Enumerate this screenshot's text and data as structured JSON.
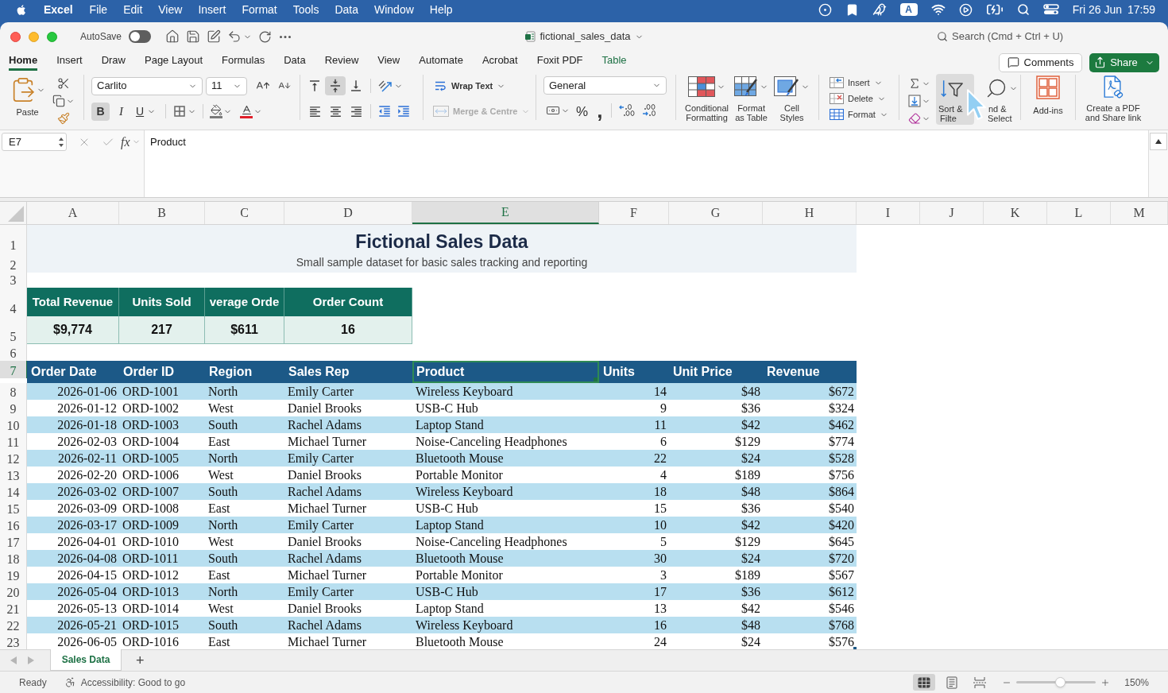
{
  "menu_bar": {
    "app_name": "Excel",
    "menus": [
      "File",
      "Edit",
      "View",
      "Insert",
      "Format",
      "Tools",
      "Data",
      "Window",
      "Help"
    ],
    "input_source": "A",
    "date": "Fri 26 Jun",
    "time": "17:59"
  },
  "title_bar": {
    "autosave": {
      "label": "AutoSave",
      "on": false
    },
    "file_name": "fictional_sales_data",
    "search": {
      "placeholder": "Search (Cmd + Ctrl + U)"
    }
  },
  "ribbon_tabs": [
    {
      "label": "Home",
      "selected": true,
      "contextual": false
    },
    {
      "label": "Insert",
      "selected": false,
      "contextual": false
    },
    {
      "label": "Draw",
      "selected": false,
      "contextual": false
    },
    {
      "label": "Page Layout",
      "selected": false,
      "contextual": false
    },
    {
      "label": "Formulas",
      "selected": false,
      "contextual": false
    },
    {
      "label": "Data",
      "selected": false,
      "contextual": false
    },
    {
      "label": "Review",
      "selected": false,
      "contextual": false
    },
    {
      "label": "View",
      "selected": false,
      "contextual": false
    },
    {
      "label": "Automate",
      "selected": false,
      "contextual": false
    },
    {
      "label": "Acrobat",
      "selected": false,
      "contextual": false
    },
    {
      "label": "Foxit PDF",
      "selected": false,
      "contextual": false
    },
    {
      "label": "Table",
      "selected": false,
      "contextual": true
    }
  ],
  "comments_button": {
    "label": "Comments"
  },
  "share_button": {
    "label": "Share"
  },
  "ribbon": {
    "paste": {
      "label": "Paste"
    },
    "font_name": "Carlito",
    "font_size": "11",
    "text_styles": [
      {
        "label": "B",
        "kind": "bold",
        "selected": true
      },
      {
        "label": "I",
        "kind": "italic",
        "selected": false
      },
      {
        "label": "U",
        "kind": "underline",
        "selected": false
      }
    ],
    "vertical_align": [
      {
        "kind": "top",
        "selected": false
      },
      {
        "kind": "middle",
        "selected": true
      },
      {
        "kind": "bottom",
        "selected": false
      }
    ],
    "wrap_text": {
      "label": "Wrap Text",
      "disabled": false
    },
    "merge_centre": {
      "label": "Merge & Centre",
      "disabled": true
    },
    "number_format": "General",
    "percent_symbol": "%",
    "comma_symbol": ",",
    "style_buttons": [
      {
        "kind": "conditional",
        "lines": [
          "Conditional",
          "Formatting"
        ]
      },
      {
        "kind": "table",
        "lines": [
          "Format",
          "as Table"
        ]
      },
      {
        "kind": "cell",
        "lines": [
          "Cell",
          "Styles"
        ]
      }
    ],
    "cells_buttons": [
      {
        "kind": "insert",
        "label": "Insert"
      },
      {
        "kind": "delete",
        "label": "Delete"
      },
      {
        "kind": "format",
        "label": "Format"
      }
    ],
    "sort_filter": {
      "lines": [
        "Sort &",
        "Filte"
      ],
      "hovered": true
    },
    "find_select": {
      "lines": [
        "nd &",
        "Select"
      ]
    },
    "add_ins": {
      "label": "Add-ins"
    },
    "create_pdf": {
      "lines": [
        "Create a PDF",
        "and Share link"
      ]
    }
  },
  "formula_bar": {
    "name_box": "E7",
    "function_label": "fx",
    "value": "Product"
  },
  "sheet": {
    "columns": [
      {
        "label": "A",
        "selected": false
      },
      {
        "label": "B",
        "selected": false
      },
      {
        "label": "C",
        "selected": false
      },
      {
        "label": "D",
        "selected": false
      },
      {
        "label": "E",
        "selected": true
      },
      {
        "label": "F",
        "selected": false
      },
      {
        "label": "G",
        "selected": false
      },
      {
        "label": "H",
        "selected": false
      },
      {
        "label": "I",
        "selected": false
      },
      {
        "label": "J",
        "selected": false
      },
      {
        "label": "K",
        "selected": false
      },
      {
        "label": "L",
        "selected": false
      },
      {
        "label": "M",
        "selected": false
      }
    ],
    "rows": [
      {
        "label": "1",
        "selected": false
      },
      {
        "label": "2",
        "selected": false
      },
      {
        "label": "3",
        "selected": false
      },
      {
        "label": "4",
        "selected": false
      },
      {
        "label": "5",
        "selected": false
      },
      {
        "label": "6",
        "selected": false
      },
      {
        "label": "7",
        "selected": true
      },
      {
        "label": "8",
        "selected": false
      },
      {
        "label": "9",
        "selected": false
      },
      {
        "label": "10",
        "selected": false
      },
      {
        "label": "11",
        "selected": false
      },
      {
        "label": "12",
        "selected": false
      },
      {
        "label": "13",
        "selected": false
      },
      {
        "label": "14",
        "selected": false
      },
      {
        "label": "15",
        "selected": false
      },
      {
        "label": "16",
        "selected": false
      },
      {
        "label": "17",
        "selected": false
      },
      {
        "label": "18",
        "selected": false
      },
      {
        "label": "19",
        "selected": false
      },
      {
        "label": "20",
        "selected": false
      },
      {
        "label": "21",
        "selected": false
      },
      {
        "label": "22",
        "selected": false
      },
      {
        "label": "23",
        "selected": false
      }
    ],
    "title": "Fictional Sales Data",
    "subtitle": "Small sample dataset for basic sales tracking and reporting",
    "kpis": [
      {
        "label": "Total Revenue",
        "value": "$9,774"
      },
      {
        "label": "Units Sold",
        "value": "217"
      },
      {
        "label": "verage Orde",
        "value": "$611"
      },
      {
        "label": "Order Count",
        "value": "16"
      }
    ],
    "table": {
      "columns": [
        {
          "label": "Order Date",
          "kind": "date",
          "selected": false
        },
        {
          "label": "Order ID",
          "kind": "text",
          "selected": false
        },
        {
          "label": "Region",
          "kind": "text",
          "selected": false
        },
        {
          "label": "Sales Rep",
          "kind": "text",
          "selected": false
        },
        {
          "label": "Product",
          "kind": "text",
          "selected": true
        },
        {
          "label": "Units",
          "kind": "number",
          "selected": false
        },
        {
          "label": "Unit Price",
          "kind": "number",
          "selected": false
        },
        {
          "label": "Revenue",
          "kind": "number",
          "selected": false
        }
      ],
      "rows": [
        [
          "2026-01-06",
          "ORD-1001",
          "North",
          "Emily Carter",
          "Wireless Keyboard",
          "14",
          "$48",
          "$672"
        ],
        [
          "2026-01-12",
          "ORD-1002",
          "West",
          "Daniel Brooks",
          "USB-C Hub",
          "9",
          "$36",
          "$324"
        ],
        [
          "2026-01-18",
          "ORD-1003",
          "South",
          "Rachel Adams",
          "Laptop Stand",
          "11",
          "$42",
          "$462"
        ],
        [
          "2026-02-03",
          "ORD-1004",
          "East",
          "Michael Turner",
          "Noise-Canceling Headphones",
          "6",
          "$129",
          "$774"
        ],
        [
          "2026-02-11",
          "ORD-1005",
          "North",
          "Emily Carter",
          "Bluetooth Mouse",
          "22",
          "$24",
          "$528"
        ],
        [
          "2026-02-20",
          "ORD-1006",
          "West",
          "Daniel Brooks",
          "Portable Monitor",
          "4",
          "$189",
          "$756"
        ],
        [
          "2026-03-02",
          "ORD-1007",
          "South",
          "Rachel Adams",
          "Wireless Keyboard",
          "18",
          "$48",
          "$864"
        ],
        [
          "2026-03-09",
          "ORD-1008",
          "East",
          "Michael Turner",
          "USB-C Hub",
          "15",
          "$36",
          "$540"
        ],
        [
          "2026-03-17",
          "ORD-1009",
          "North",
          "Emily Carter",
          "Laptop Stand",
          "10",
          "$42",
          "$420"
        ],
        [
          "2026-04-01",
          "ORD-1010",
          "West",
          "Daniel Brooks",
          "Noise-Canceling Headphones",
          "5",
          "$129",
          "$645"
        ],
        [
          "2026-04-08",
          "ORD-1011",
          "South",
          "Rachel Adams",
          "Bluetooth Mouse",
          "30",
          "$24",
          "$720"
        ],
        [
          "2026-04-15",
          "ORD-1012",
          "East",
          "Michael Turner",
          "Portable Monitor",
          "3",
          "$189",
          "$567"
        ],
        [
          "2026-05-04",
          "ORD-1013",
          "North",
          "Emily Carter",
          "USB-C Hub",
          "17",
          "$36",
          "$612"
        ],
        [
          "2026-05-13",
          "ORD-1014",
          "West",
          "Daniel Brooks",
          "Laptop Stand",
          "13",
          "$42",
          "$546"
        ],
        [
          "2026-05-21",
          "ORD-1015",
          "South",
          "Rachel Adams",
          "Wireless Keyboard",
          "16",
          "$48",
          "$768"
        ],
        [
          "2026-06-05",
          "ORD-1016",
          "East",
          "Michael Turner",
          "Bluetooth Mouse",
          "24",
          "$24",
          "$576"
        ]
      ]
    }
  },
  "sheet_tabs": [
    {
      "label": "Sales Data",
      "selected": true
    }
  ],
  "add_sheet": "+",
  "status_bar": {
    "status": "Ready",
    "accessibility": "Accessibility: Good to go",
    "views": [
      {
        "kind": "normal",
        "selected": true
      },
      {
        "kind": "page_layout",
        "selected": false
      },
      {
        "kind": "page_break",
        "selected": false
      }
    ],
    "zoom": {
      "level": 0.55,
      "reading": "150%"
    }
  }
}
